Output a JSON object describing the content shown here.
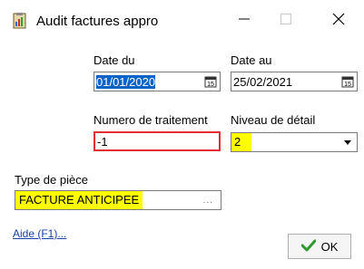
{
  "window": {
    "title": "Audit factures appro",
    "icon": "clipboard-chart-icon",
    "minimize_icon": "minimize-icon",
    "maximize_icon": "maximize-icon",
    "close_icon": "close-icon"
  },
  "form": {
    "date_du": {
      "label": "Date du",
      "value": "01/01/2020",
      "icon": "calendar-icon"
    },
    "date_au": {
      "label": "Date au",
      "value": "25/02/2021",
      "icon": "calendar-icon"
    },
    "numero": {
      "label": "Numero de traitement",
      "value": "-1"
    },
    "niveau": {
      "label": "Niveau de détail",
      "value": "2",
      "icon": "chevron-down-icon"
    },
    "type_piece": {
      "label": "Type de pièce",
      "value": "FACTURE ANTICIPEE",
      "button": "..."
    }
  },
  "footer": {
    "help_label": "Aide (F1)...",
    "ok_label": "OK",
    "ok_icon": "checkmark-icon"
  },
  "colors": {
    "highlight": "#ffff00",
    "error_border": "#e03030",
    "selection": "#0a64c8",
    "link": "#1a3fa8",
    "ok_check": "#2e9a2e"
  }
}
